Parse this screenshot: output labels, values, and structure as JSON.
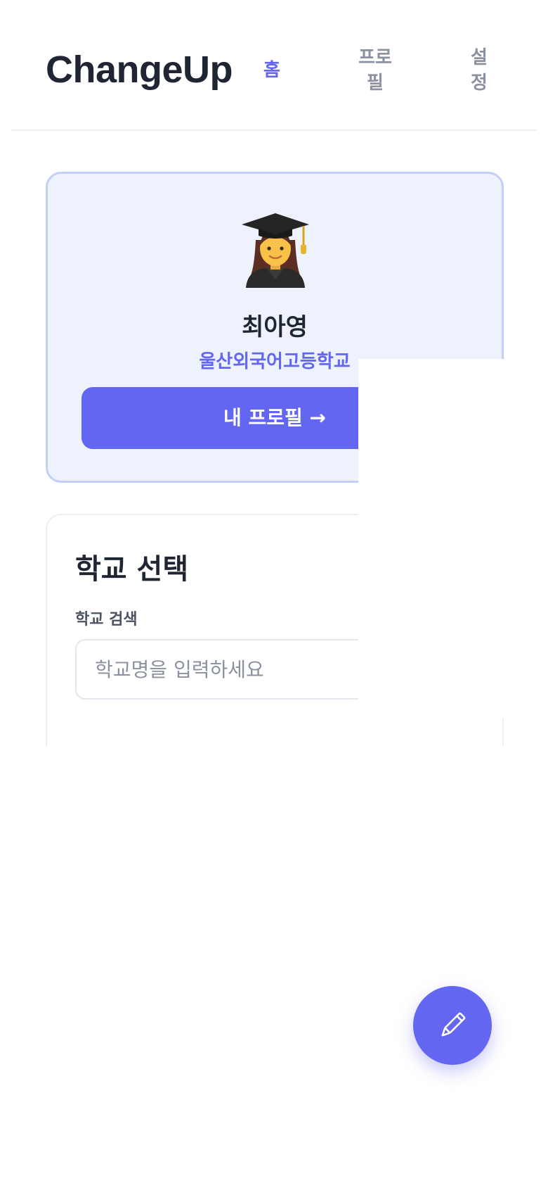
{
  "header": {
    "brand": "ChangeUp",
    "nav": {
      "home": "홈",
      "profile": "프로필",
      "settings": "설정"
    }
  },
  "profile": {
    "avatar_icon": "student-graduate-icon",
    "name": "최아영",
    "school": "울산외국어고등학교",
    "button_label": "내 프로필 →"
  },
  "school_select": {
    "title": "학교 선택",
    "search_label": "학교 검색",
    "search_placeholder": "학교명을 입력하세요",
    "search_value": ""
  },
  "fab": {
    "icon": "pencil-icon"
  },
  "colors": {
    "accent": "#6366f1",
    "card_bg": "#eef2fd",
    "card_border": "#c3cff6",
    "text": "#1f2533",
    "muted": "#8a91a0"
  }
}
